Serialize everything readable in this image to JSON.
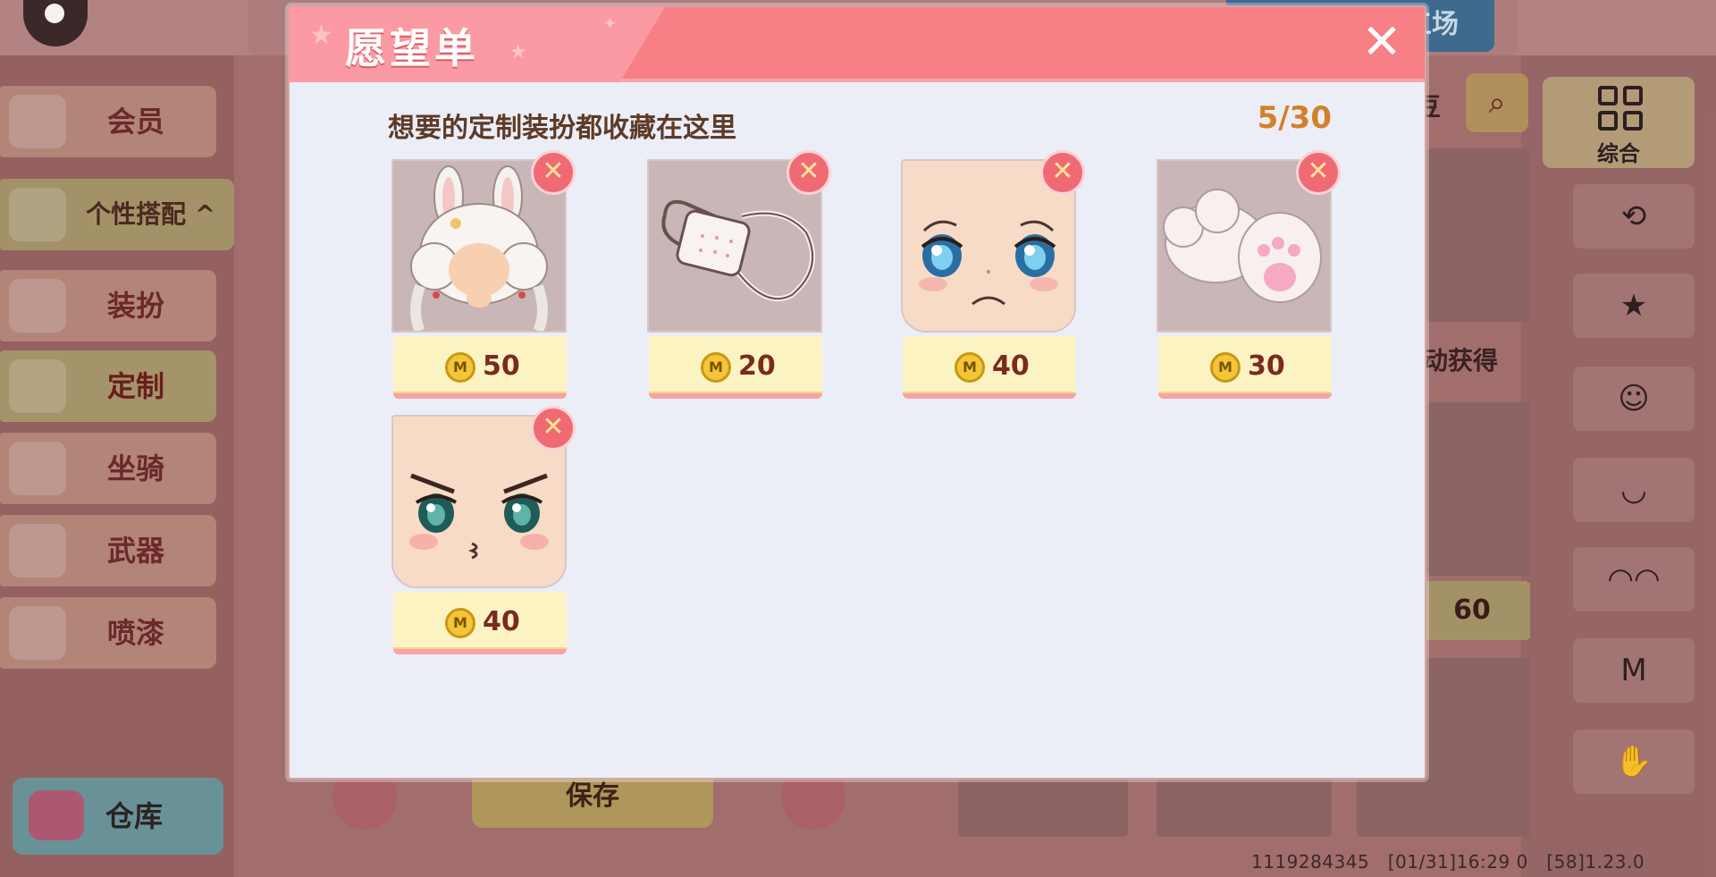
{
  "background": {
    "top": {
      "workshop_tab": "工场"
    },
    "sidebar": {
      "items": [
        {
          "label": "会员",
          "icon": "vip-icon"
        },
        {
          "label": "个性搭配",
          "icon": "style-icon",
          "expanded": true
        },
        {
          "label": "装扮",
          "icon": "outfit-icon"
        },
        {
          "label": "定制",
          "icon": "customize-icon",
          "active": true
        },
        {
          "label": "坐骑",
          "icon": "mount-icon"
        },
        {
          "label": "武器",
          "icon": "weapon-icon"
        },
        {
          "label": "喷漆",
          "icon": "spray-icon"
        }
      ],
      "group_chevron": "^",
      "warehouse": "仓库"
    },
    "main": {
      "save_label": "保存",
      "dou_label": "豆",
      "acquire_label": "动获得",
      "price_visible": "60"
    },
    "right_panel": {
      "comprehensive_label": "综合",
      "icons": [
        "history-icon",
        "bodysuit-icon",
        "hair-icon",
        "face-icon",
        "mask-icon",
        "shirt-icon",
        "hand-icon"
      ]
    },
    "footer": {
      "uid": "1119284345",
      "time": "[01/31]16:29 0",
      "version": "[58]1.23.0"
    }
  },
  "wishlist": {
    "title": "愿望单",
    "close_symbol": "✕",
    "subtitle": "想要的定制装扮都收藏在这里",
    "count": "5/30",
    "remove_symbol": "✕",
    "coin_symbol": "M",
    "items": [
      {
        "name": "bunny-ear-hair",
        "price": "50"
      },
      {
        "name": "face-mask",
        "price": "20"
      },
      {
        "name": "teary-face",
        "price": "40"
      },
      {
        "name": "paw-gloves",
        "price": "30"
      },
      {
        "name": "pouty-face",
        "price": "40"
      }
    ]
  },
  "colors": {
    "header": "#f77f86",
    "dialog_bg": "#eceef7",
    "price_bg": "#fbf4c2",
    "counter": "#d4802a",
    "remove": "#f06a74"
  }
}
